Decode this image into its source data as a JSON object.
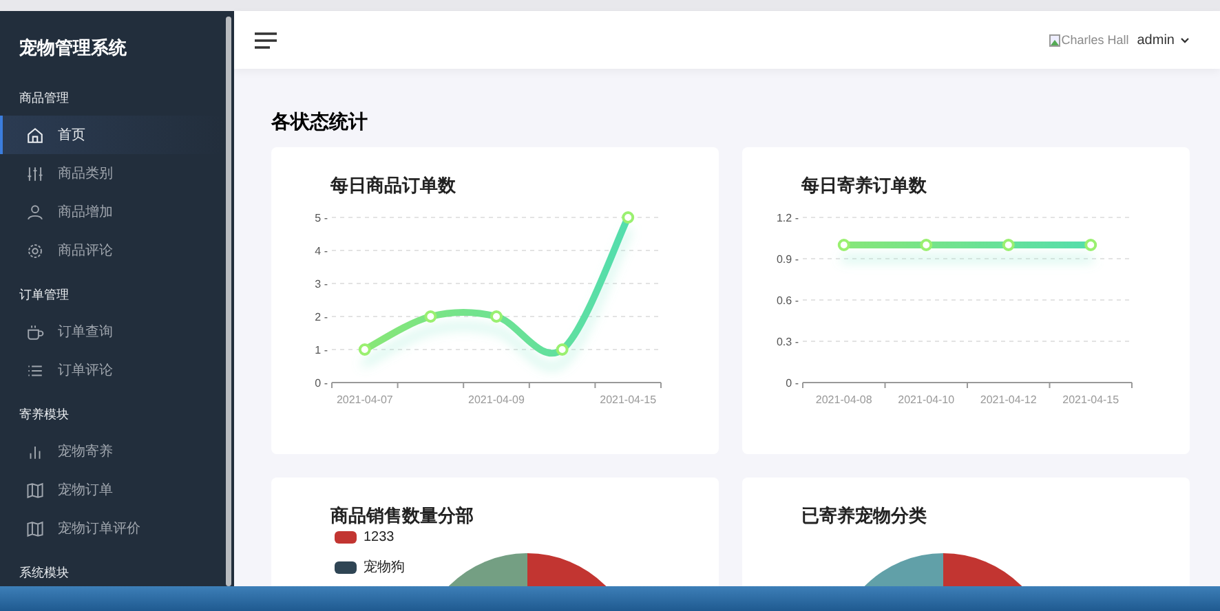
{
  "sidebar": {
    "title": "宠物管理系统",
    "sections": [
      {
        "heading": "商品管理",
        "items": [
          {
            "label": "首页",
            "selected": true
          },
          {
            "label": "商品类别",
            "selected": false
          },
          {
            "label": "商品增加",
            "selected": false
          },
          {
            "label": "商品评论",
            "selected": false
          }
        ]
      },
      {
        "heading": "订单管理",
        "items": [
          {
            "label": "订单查询",
            "selected": false
          },
          {
            "label": "订单评论",
            "selected": false
          }
        ]
      },
      {
        "heading": "寄养模块",
        "items": [
          {
            "label": "宠物寄养",
            "selected": false
          },
          {
            "label": "宠物订单",
            "selected": false
          },
          {
            "label": "宠物订单评价",
            "selected": false
          }
        ]
      },
      {
        "heading": "系统模块"
      }
    ]
  },
  "header": {
    "avatar_alt": "Charles Hall",
    "user": "admin"
  },
  "page_title": "各状态统计",
  "line_charts": [
    {
      "title": "每日商品订单数",
      "chart_data": {
        "type": "line",
        "categories": [
          "2021-04-07",
          null,
          "2021-04-09",
          null,
          "2021-04-15"
        ],
        "series": [
          {
            "color": "#4cdcb4",
            "marker": true,
            "values": [
              1,
              2,
              2,
              1,
              5
            ]
          }
        ],
        "ylim": [
          0,
          5
        ],
        "grid": true,
        "yticks": [
          {
            "value": 0,
            "label": "0 -"
          },
          {
            "value": 1,
            "label": "1 -"
          },
          {
            "value": 2,
            "label": "2 -"
          },
          {
            "value": 3,
            "label": "3 -"
          },
          {
            "value": 4,
            "label": "4 -"
          },
          {
            "value": 5,
            "label": "5 -"
          }
        ]
      }
    },
    {
      "title": "每日寄养订单数",
      "chart_data": {
        "type": "line",
        "categories": [
          "2021-04-08",
          "2021-04-10",
          "2021-04-12",
          "2021-04-15"
        ],
        "series": [
          {
            "color": "#4cdcb4",
            "marker": true,
            "values": [
              1,
              1,
              1,
              1
            ]
          }
        ],
        "ylim": [
          0,
          1.2
        ],
        "grid": true,
        "yticks": [
          {
            "value": 0,
            "label": "0 -"
          },
          {
            "value": 0.3,
            "label": "0.3 -"
          },
          {
            "value": 0.6,
            "label": "0.6 -"
          },
          {
            "value": 0.9,
            "label": "0.9 -"
          },
          {
            "value": 1.2,
            "label": "1.2 -"
          }
        ]
      }
    }
  ],
  "pie_cards": [
    {
      "title": "商品销售数量分部",
      "legend": [
        {
          "label": "1233",
          "color": "#c23531"
        },
        {
          "label": "宠物狗",
          "color": "#2f4554"
        }
      ]
    },
    {
      "title": "已寄养宠物分类"
    }
  ]
}
